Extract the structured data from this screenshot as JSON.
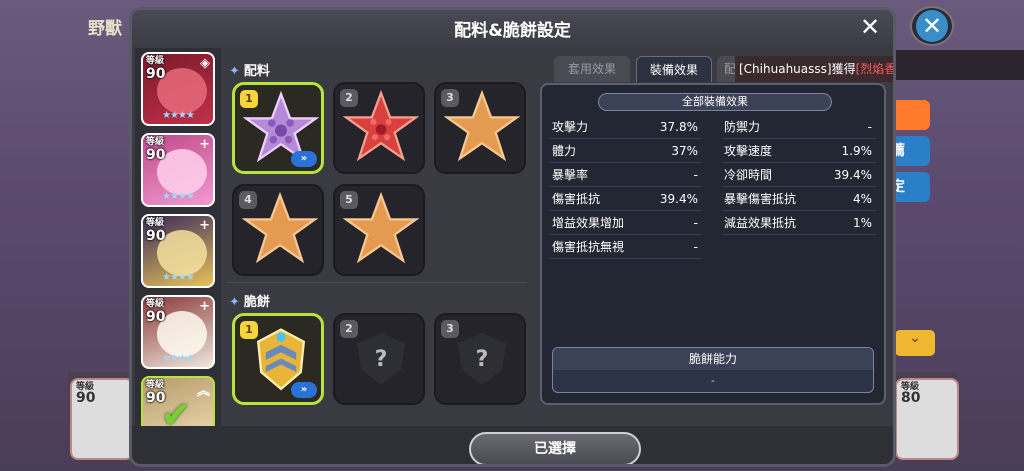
{
  "background": {
    "title": "野獸",
    "side_buttons": [
      "薦",
      "定"
    ],
    "bottom_cards": [
      {
        "level_label": "等級",
        "level": "90"
      },
      {
        "level_label": "等級",
        "level": "80"
      }
    ]
  },
  "modal": {
    "title": "配料&脆餅設定",
    "close_symbol": "✕"
  },
  "cookies": [
    {
      "level_label": "等級",
      "level": "90",
      "corner": "◈",
      "color": "#c0304a"
    },
    {
      "level_label": "等級",
      "level": "90",
      "corner": "+",
      "color": "#e86ab8"
    },
    {
      "level_label": "等級",
      "level": "90",
      "corner": "+",
      "color": "#e8c25a"
    },
    {
      "level_label": "等級",
      "level": "90",
      "corner": "+",
      "color": "#d8cfc4"
    },
    {
      "level_label": "等級",
      "level": "90",
      "corner": "︽",
      "color": "#e8d59a",
      "selected": true
    }
  ],
  "toppings": {
    "label": "配料",
    "slots": [
      {
        "num": "1",
        "kind": "purple-star",
        "active": true,
        "arrow": "»"
      },
      {
        "num": "2",
        "kind": "red-star"
      },
      {
        "num": "3",
        "kind": "empty-star"
      },
      {
        "num": "4",
        "kind": "empty-star"
      },
      {
        "num": "5",
        "kind": "empty-star"
      }
    ]
  },
  "biscuits": {
    "label": "脆餅",
    "slots": [
      {
        "num": "1",
        "kind": "gold-emblem",
        "active": true,
        "arrow": "»"
      },
      {
        "num": "2",
        "kind": "unknown",
        "q": "?"
      },
      {
        "num": "3",
        "kind": "unknown",
        "q": "?"
      }
    ]
  },
  "tabs": [
    {
      "label": "套用效果",
      "active": false
    },
    {
      "label": "裝備效果",
      "active": true
    },
    {
      "label": "配",
      "active": false
    }
  ],
  "notice": {
    "prefix": "[Chihuahuasss]獲得",
    "name": "[烈焰香料餅乾]"
  },
  "effects": {
    "header": "全部裝備效果",
    "left": [
      {
        "k": "攻擊力",
        "v": "37.8%"
      },
      {
        "k": "體力",
        "v": "37%"
      },
      {
        "k": "暴擊率",
        "v": "-"
      },
      {
        "k": "傷害抵抗",
        "v": "39.4%"
      },
      {
        "k": "增益效果增加",
        "v": "-"
      },
      {
        "k": "傷害抵抗無視",
        "v": "-"
      }
    ],
    "right": [
      {
        "k": "防禦力",
        "v": "-"
      },
      {
        "k": "攻擊速度",
        "v": "1.9%"
      },
      {
        "k": "冷卻時間",
        "v": "39.4%"
      },
      {
        "k": "暴擊傷害抵抗",
        "v": "4%"
      },
      {
        "k": "減益效果抵抗",
        "v": "1%"
      }
    ],
    "ability_header": "脆餅能力",
    "ability_value": "-"
  },
  "footer": {
    "select_label": "已選擇"
  }
}
